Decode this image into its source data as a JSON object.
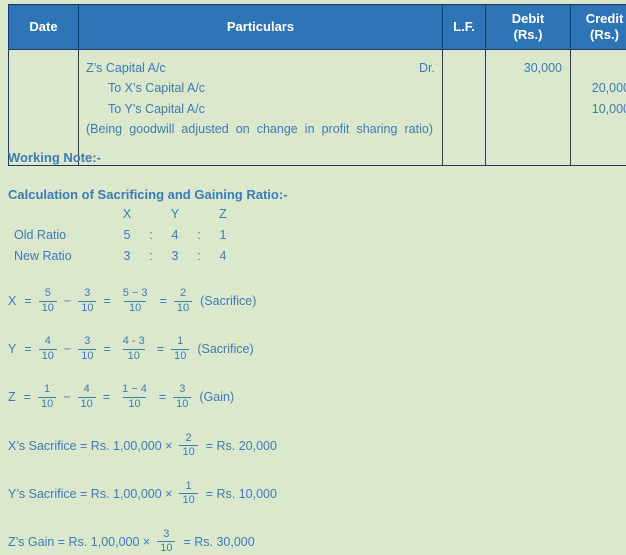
{
  "table": {
    "headers": [
      {
        "line1": "Date",
        "line2": ""
      },
      {
        "line1": "Particulars",
        "line2": ""
      },
      {
        "line1": "L.F.",
        "line2": ""
      },
      {
        "line1": "Debit",
        "line2": "(Rs.)"
      },
      {
        "line1": "Credit",
        "line2": "(Rs.)"
      }
    ],
    "row": {
      "date": "",
      "lf": "",
      "entry": {
        "debit_account": "Z’s Capital A/c",
        "dr_marker": "Dr.",
        "credit_accounts": [
          "To X’s Capital A/c",
          "To Y’s Capital A/c"
        ],
        "narration": "(Being goodwill adjusted on change in profit sharing ratio)"
      },
      "debit_amounts": [
        "30,000"
      ],
      "credit_amounts": [
        "20,000",
        "10,000"
      ]
    }
  },
  "note": {
    "working_note_heading": "Working Note:-",
    "calculation_heading": "Calculation of Sacrificing and Gaining Ratio:-",
    "ratio_table": {
      "partners": [
        "X",
        "Y",
        "Z"
      ],
      "colon": ":",
      "rows": [
        {
          "label": "Old Ratio",
          "values": [
            "5",
            "4",
            "1"
          ]
        },
        {
          "label": "New Ratio",
          "values": [
            "3",
            "3",
            "4"
          ]
        }
      ]
    },
    "equations": [
      {
        "partner": "X",
        "equals": "=",
        "old": {
          "num": "5",
          "den": "10"
        },
        "minus": "−",
        "new": {
          "num": "3",
          "den": "10"
        },
        "eq2": "=",
        "diff": {
          "num": "5 − 3",
          "den": "10"
        },
        "eq3": "=",
        "result": {
          "num": "2",
          "den": "10"
        },
        "label": "(Sacrifice)"
      },
      {
        "partner": "Y",
        "equals": "=",
        "old": {
          "num": "4",
          "den": "10"
        },
        "minus": "−",
        "new": {
          "num": "3",
          "den": "10"
        },
        "eq2": "=",
        "diff": {
          "num": "4 - 3",
          "den": "10"
        },
        "eq3": "=",
        "result": {
          "num": "1",
          "den": "10"
        },
        "label": "(Sacrifice)"
      },
      {
        "partner": "Z",
        "equals": "=",
        "old": {
          "num": "1",
          "den": "10"
        },
        "minus": "−",
        "new": {
          "num": "4",
          "den": "10"
        },
        "eq2": "=",
        "diff": {
          "num": "1 − 4",
          "den": "10"
        },
        "eq3": "=",
        "result": {
          "num": "3",
          "den": "10"
        },
        "label": "(Gain)"
      }
    ],
    "amount_lines": [
      {
        "lead": "X’s Sacrifice = Rs. 1,00,000 ×",
        "fraction": {
          "num": "2",
          "den": "10"
        },
        "tail": "= Rs. 20,000"
      },
      {
        "lead": "Y’s Sacrifice = Rs. 1,00,000 ×",
        "fraction": {
          "num": "1",
          "den": "10"
        },
        "tail": "= Rs. 10,000"
      },
      {
        "lead": "Z’s Gain = Rs. 1,00,000 ×",
        "fraction": {
          "num": "3",
          "den": "10"
        },
        "tail": "= Rs. 30,000"
      }
    ]
  },
  "colors": {
    "header_blue": "#2e75b6",
    "page_background": "#dce8cc",
    "text_blue": "#3a7cb8",
    "border_navy": "#1f3864"
  }
}
